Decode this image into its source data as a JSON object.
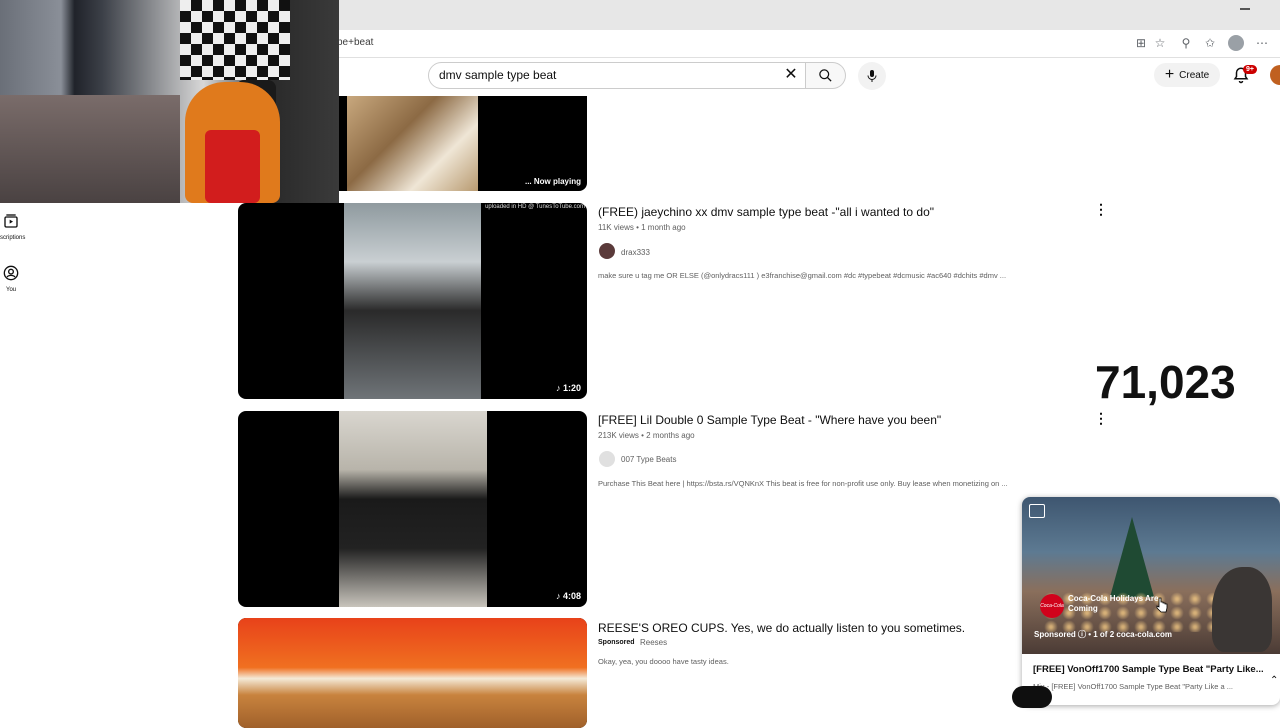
{
  "browser": {
    "url": "ype+beat"
  },
  "search": {
    "query": "dmv sample type beat"
  },
  "header": {
    "create_label": "Create",
    "notification_count": "9+"
  },
  "nav": {
    "subscriptions_label": "scriptions",
    "you_label": "You"
  },
  "now_playing": {
    "label": "... Now playing"
  },
  "results": [
    {
      "title": "(FREE) jaeychino xx dmv sample type beat -\"all i wanted to do\"",
      "meta": "11K views • 1 month ago",
      "channel": "drax333",
      "description": "make sure u tag me OR ELSE (@onlydracs111 ) e3franchise@gmail.com #dc #typebeat #dcmusic #ac640 #dchits #dmv ...",
      "duration": "1:20",
      "overlay": "uploaded in HD @ TunesToTube.com"
    },
    {
      "title": "[FREE] Lil Double 0 Sample Type Beat - \"Where have you been\"",
      "meta": "213K views • 2 months ago",
      "channel": "007 Type Beats",
      "description": "Purchase This Beat here | https://bsta.rs/VQNKnX This beat is free for non-profit use only. Buy lease when monetizing on ...",
      "duration": "4:08"
    },
    {
      "title": "REESE'S OREO CUPS. Yes, we do actually listen to you sometimes.",
      "sponsored_label": "Sponsored",
      "channel": "Reeses",
      "description": "Okay, yea, you doooo have tasty ideas."
    }
  ],
  "counter": "71,023",
  "ad": {
    "logo_text": "Coca-Cola",
    "headline": "Coca-Cola Holidays Are Coming",
    "sponsored_row": "Sponsored  ⓘ • 1 of 2    coca-cola.com",
    "video_title": "[FREE] VonOff1700 Sample Type Beat \"Party Like...",
    "video_sub": "Mix - [FREE] VonOff1700 Sample Type Beat \"Party Like a ..."
  }
}
